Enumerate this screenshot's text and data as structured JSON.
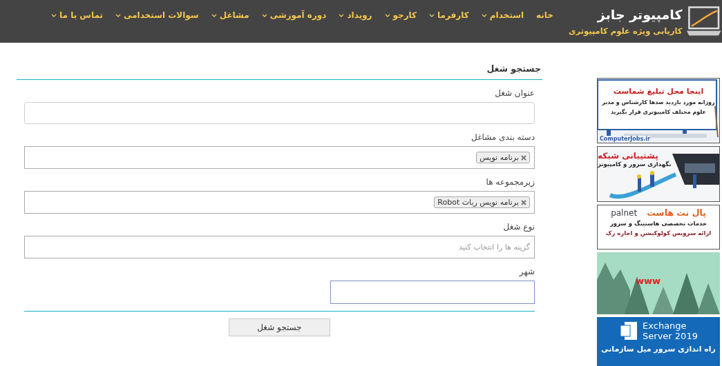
{
  "header": {
    "logo": {
      "title": "کامپیوتر جابز",
      "subtitle": "کاریابی ویژه علوم کامپیوتری"
    },
    "nav": [
      {
        "label": "خانه",
        "dropdown": false
      },
      {
        "label": "استخدام",
        "dropdown": true
      },
      {
        "label": "کارفرما",
        "dropdown": true
      },
      {
        "label": "کارجو",
        "dropdown": true
      },
      {
        "label": "رویداد",
        "dropdown": true
      },
      {
        "label": "دوره آموزشی",
        "dropdown": true
      },
      {
        "label": "مشاغل",
        "dropdown": true
      },
      {
        "label": "سوالات استخدامی",
        "dropdown": true
      },
      {
        "label": "تماس با ما",
        "dropdown": true
      }
    ]
  },
  "form": {
    "title": "جستجو شغل",
    "fields": [
      {
        "kind": "text",
        "label": "عنوان شغل"
      },
      {
        "kind": "tags",
        "label": "دسته بندی مشاغل",
        "tags": [
          "برنامه نویس"
        ]
      },
      {
        "kind": "tags",
        "label": "زیرمجموعه ها",
        "tags": [
          "برنامه نویس ربات Robot"
        ]
      },
      {
        "kind": "select",
        "label": "نوع شغل",
        "placeholder": "گزینه ها را انتخاب کنید"
      },
      {
        "kind": "city",
        "label": "شهر",
        "focused": true
      }
    ],
    "submit": "جستجو شغل"
  },
  "ads": [
    {
      "kind": "billboard",
      "title": "اینجا محل تبلیغ شماست",
      "lines": [
        "روزانه مورد بازدید صدها کارشناس و مدیر",
        "علوم مختلف کامپیوتری قرار بگیرید"
      ],
      "caption": "ComputerJobs.ir"
    },
    {
      "kind": "network",
      "title": "پشتیبانی شبکه",
      "lines": [
        "نگهداری سرور و کامپیوتر"
      ]
    },
    {
      "kind": "hosting",
      "brand": "palnet",
      "title": "پال نت هاست",
      "lines": [
        "خدمات تخصصی هاستینگ و سرور",
        "ارائه سرویس کولوکیشن و اجاره رک"
      ]
    },
    {
      "kind": "forest",
      "title": "www"
    },
    {
      "kind": "exchange",
      "title": "Exchange",
      "subtitle": "Server 2019",
      "lines": [
        "راه اندازی سرور میل سازمانی"
      ]
    }
  ]
}
